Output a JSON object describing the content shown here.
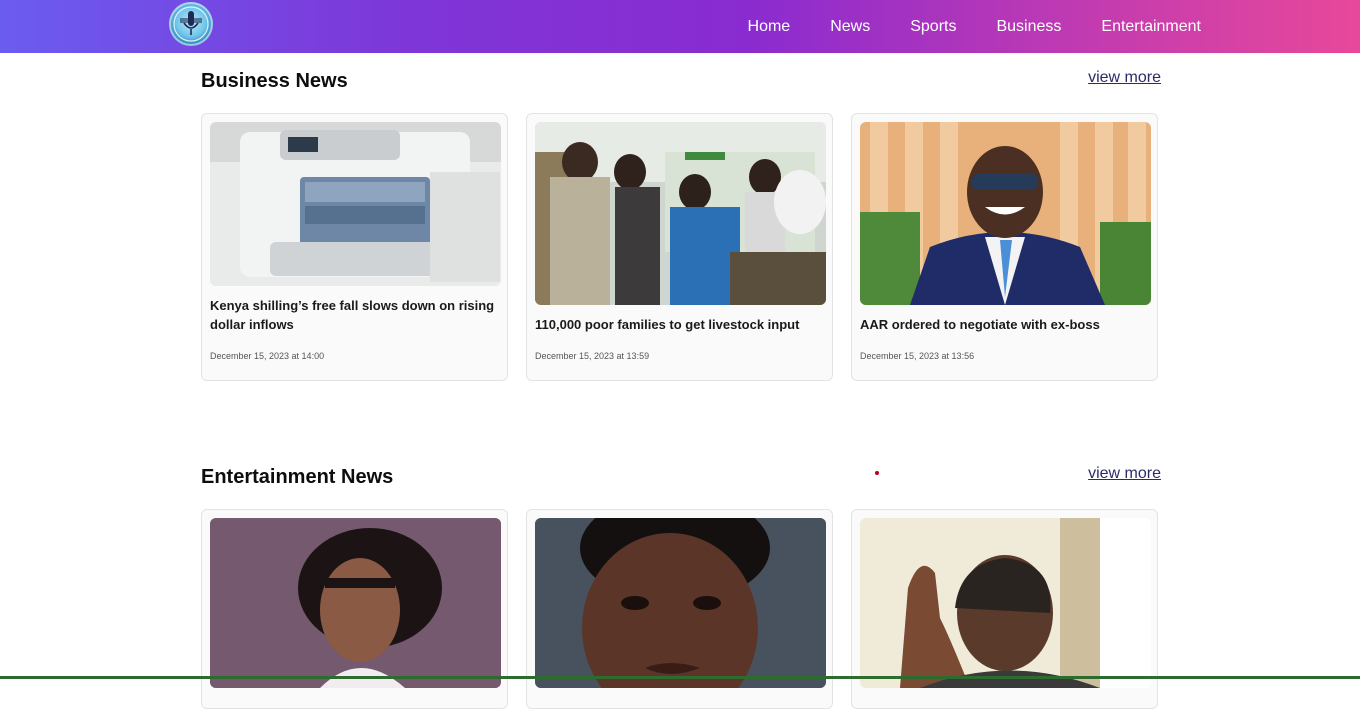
{
  "nav": {
    "logo_alt": "logo",
    "links": [
      "Home",
      "News",
      "Sports",
      "Business",
      "Entertainment"
    ]
  },
  "sections": {
    "business": {
      "title": "Business News",
      "view_more": "view more",
      "cards": [
        {
          "title": "Kenya shilling’s free fall slows down on rising dollar inflows",
          "date": "December 15, 2023 at 14:00",
          "image": "money-counter-image"
        },
        {
          "title": "110,000 poor families to get livestock input",
          "date": "December 15, 2023 at 13:59",
          "image": "seeds-shop-crowd-image"
        },
        {
          "title": "AAR ordered to negotiate with ex-boss",
          "date": "December 15, 2023 at 13:56",
          "image": "smiling-man-suit-image"
        }
      ]
    },
    "entertainment": {
      "title": "Entertainment News",
      "view_more": "view more",
      "cards": [
        {
          "image": "woman-braids-portrait-image"
        },
        {
          "image": "woman-closeup-portrait-image"
        },
        {
          "image": "man-raising-hand-image"
        }
      ]
    }
  },
  "colors": {
    "nav_gradient_start": "#6b5cf0",
    "nav_gradient_end": "#e8489a",
    "link_color": "#2b2b6a"
  }
}
